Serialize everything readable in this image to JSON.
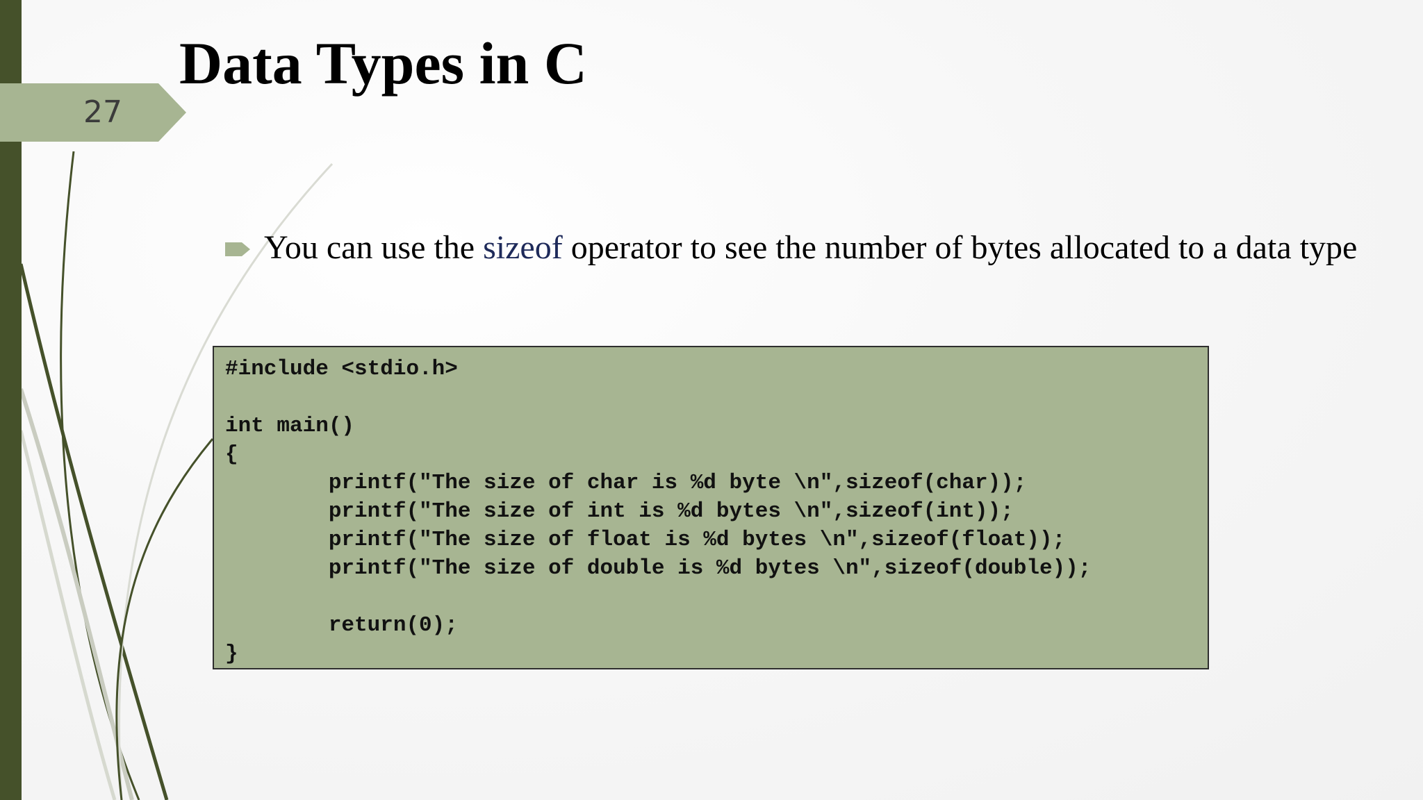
{
  "slide": {
    "title": "Data Types in C",
    "page_number": "27",
    "bullet": {
      "text_before": "You can use the ",
      "keyword": "sizeof",
      "text_after": " operator to see the number of bytes allocated to a data type"
    },
    "code": {
      "lines": [
        "#include <stdio.h>",
        "",
        "int main()",
        "{",
        "        printf(\"The size of char is %d byte \\n\",sizeof(char));",
        "        printf(\"The size of int is %d bytes \\n\",sizeof(int));",
        "        printf(\"The size of float is %d bytes \\n\",sizeof(float));",
        "        printf(\"The size of double is %d bytes \\n\",sizeof(double));",
        "",
        "        return(0);",
        "}"
      ]
    }
  },
  "colors": {
    "accent_dark": "#45512a",
    "accent_light": "#a7b592",
    "keyword": "#1e2a5a"
  }
}
